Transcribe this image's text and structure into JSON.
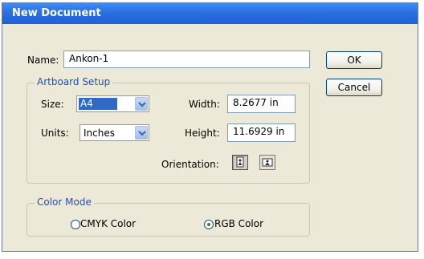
{
  "window": {
    "title": "New Document"
  },
  "name": {
    "label": "Name:",
    "value": "Ankon-1"
  },
  "buttons": {
    "ok": "OK",
    "cancel": "Cancel"
  },
  "artboard": {
    "legend": "Artboard Setup",
    "size": {
      "label": "Size:",
      "value": "A4"
    },
    "units": {
      "label": "Units:",
      "value": "Inches"
    },
    "width": {
      "label": "Width:",
      "value": "8.2677 in"
    },
    "height": {
      "label": "Height:",
      "value": "11.6929 in"
    },
    "orientation": {
      "label": "Orientation:",
      "portrait_icon": "portrait-orientation-icon",
      "landscape_icon": "landscape-orientation-icon"
    }
  },
  "color_mode": {
    "legend": "Color Mode",
    "options": [
      {
        "label": "CMYK Color",
        "selected": false
      },
      {
        "label": "RGB Color",
        "selected": true
      }
    ]
  },
  "colors": {
    "titlebar": "#2a6fe0",
    "dialog_bg": "#ece9d8",
    "selection": "#316ac5",
    "legend_text": "#1f4fb8"
  }
}
